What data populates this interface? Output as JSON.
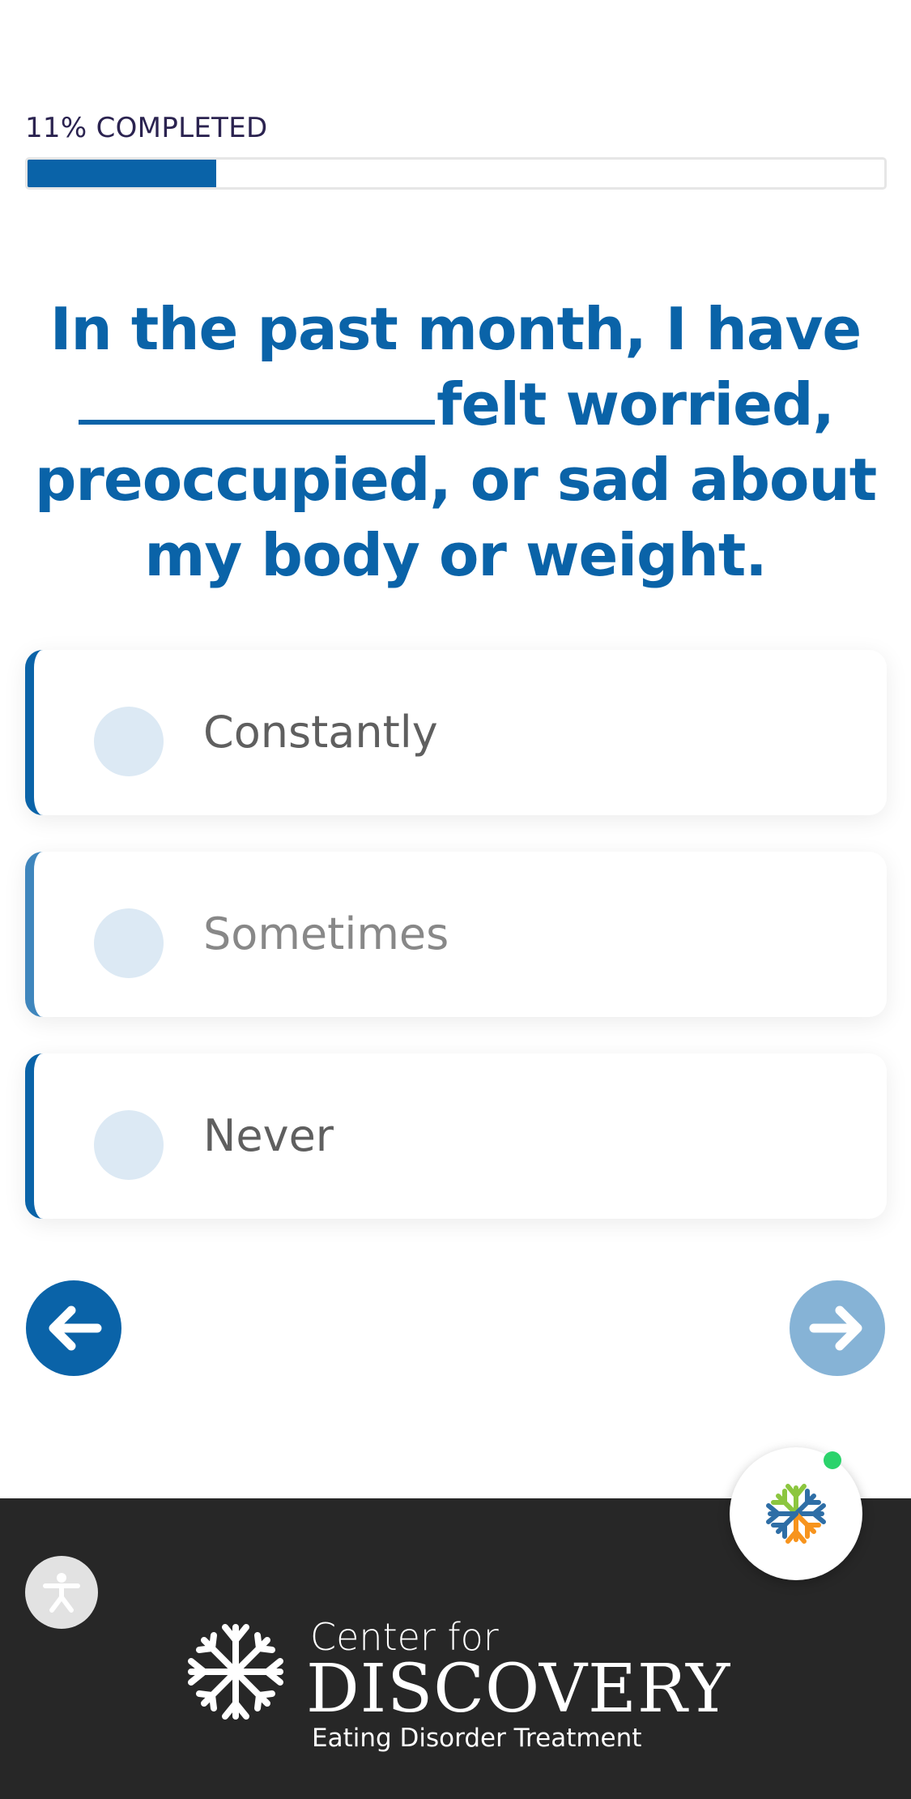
{
  "progress": {
    "label": "11% COMPLETED",
    "percent": 22
  },
  "question": {
    "part1": "In the past month, I have",
    "part2": "felt worried, preoccupied, or sad about my body or weight."
  },
  "options": [
    {
      "label": "Constantly"
    },
    {
      "label": "Sometimes"
    },
    {
      "label": "Never"
    }
  ],
  "navigation": {
    "prev_icon": "arrow-left-icon",
    "next_icon": "arrow-right-icon"
  },
  "footer": {
    "logo_line1": "Center for",
    "logo_line2": "DISCOVERY",
    "logo_line3": "Eating Disorder Treatment"
  },
  "colors": {
    "primary": "#0a63a8",
    "next_button": "#86b3d6",
    "radio": "#dce9f4",
    "footer_bg": "#272727",
    "online_dot": "#2bd36b"
  }
}
